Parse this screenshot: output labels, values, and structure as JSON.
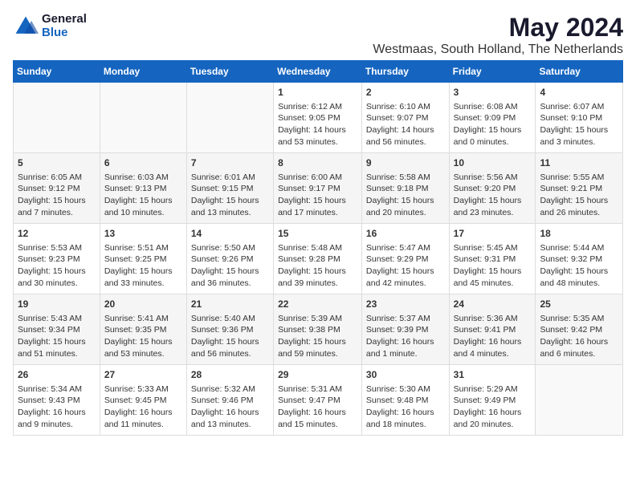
{
  "logo": {
    "general": "General",
    "blue": "Blue"
  },
  "title": {
    "month": "May 2024",
    "location": "Westmaas, South Holland, The Netherlands"
  },
  "weekdays": [
    "Sunday",
    "Monday",
    "Tuesday",
    "Wednesday",
    "Thursday",
    "Friday",
    "Saturday"
  ],
  "weeks": [
    [
      {
        "day": "",
        "content": ""
      },
      {
        "day": "",
        "content": ""
      },
      {
        "day": "",
        "content": ""
      },
      {
        "day": "1",
        "content": "Sunrise: 6:12 AM\nSunset: 9:05 PM\nDaylight: 14 hours and 53 minutes."
      },
      {
        "day": "2",
        "content": "Sunrise: 6:10 AM\nSunset: 9:07 PM\nDaylight: 14 hours and 56 minutes."
      },
      {
        "day": "3",
        "content": "Sunrise: 6:08 AM\nSunset: 9:09 PM\nDaylight: 15 hours and 0 minutes."
      },
      {
        "day": "4",
        "content": "Sunrise: 6:07 AM\nSunset: 9:10 PM\nDaylight: 15 hours and 3 minutes."
      }
    ],
    [
      {
        "day": "5",
        "content": "Sunrise: 6:05 AM\nSunset: 9:12 PM\nDaylight: 15 hours and 7 minutes."
      },
      {
        "day": "6",
        "content": "Sunrise: 6:03 AM\nSunset: 9:13 PM\nDaylight: 15 hours and 10 minutes."
      },
      {
        "day": "7",
        "content": "Sunrise: 6:01 AM\nSunset: 9:15 PM\nDaylight: 15 hours and 13 minutes."
      },
      {
        "day": "8",
        "content": "Sunrise: 6:00 AM\nSunset: 9:17 PM\nDaylight: 15 hours and 17 minutes."
      },
      {
        "day": "9",
        "content": "Sunrise: 5:58 AM\nSunset: 9:18 PM\nDaylight: 15 hours and 20 minutes."
      },
      {
        "day": "10",
        "content": "Sunrise: 5:56 AM\nSunset: 9:20 PM\nDaylight: 15 hours and 23 minutes."
      },
      {
        "day": "11",
        "content": "Sunrise: 5:55 AM\nSunset: 9:21 PM\nDaylight: 15 hours and 26 minutes."
      }
    ],
    [
      {
        "day": "12",
        "content": "Sunrise: 5:53 AM\nSunset: 9:23 PM\nDaylight: 15 hours and 30 minutes."
      },
      {
        "day": "13",
        "content": "Sunrise: 5:51 AM\nSunset: 9:25 PM\nDaylight: 15 hours and 33 minutes."
      },
      {
        "day": "14",
        "content": "Sunrise: 5:50 AM\nSunset: 9:26 PM\nDaylight: 15 hours and 36 minutes."
      },
      {
        "day": "15",
        "content": "Sunrise: 5:48 AM\nSunset: 9:28 PM\nDaylight: 15 hours and 39 minutes."
      },
      {
        "day": "16",
        "content": "Sunrise: 5:47 AM\nSunset: 9:29 PM\nDaylight: 15 hours and 42 minutes."
      },
      {
        "day": "17",
        "content": "Sunrise: 5:45 AM\nSunset: 9:31 PM\nDaylight: 15 hours and 45 minutes."
      },
      {
        "day": "18",
        "content": "Sunrise: 5:44 AM\nSunset: 9:32 PM\nDaylight: 15 hours and 48 minutes."
      }
    ],
    [
      {
        "day": "19",
        "content": "Sunrise: 5:43 AM\nSunset: 9:34 PM\nDaylight: 15 hours and 51 minutes."
      },
      {
        "day": "20",
        "content": "Sunrise: 5:41 AM\nSunset: 9:35 PM\nDaylight: 15 hours and 53 minutes."
      },
      {
        "day": "21",
        "content": "Sunrise: 5:40 AM\nSunset: 9:36 PM\nDaylight: 15 hours and 56 minutes."
      },
      {
        "day": "22",
        "content": "Sunrise: 5:39 AM\nSunset: 9:38 PM\nDaylight: 15 hours and 59 minutes."
      },
      {
        "day": "23",
        "content": "Sunrise: 5:37 AM\nSunset: 9:39 PM\nDaylight: 16 hours and 1 minute."
      },
      {
        "day": "24",
        "content": "Sunrise: 5:36 AM\nSunset: 9:41 PM\nDaylight: 16 hours and 4 minutes."
      },
      {
        "day": "25",
        "content": "Sunrise: 5:35 AM\nSunset: 9:42 PM\nDaylight: 16 hours and 6 minutes."
      }
    ],
    [
      {
        "day": "26",
        "content": "Sunrise: 5:34 AM\nSunset: 9:43 PM\nDaylight: 16 hours and 9 minutes."
      },
      {
        "day": "27",
        "content": "Sunrise: 5:33 AM\nSunset: 9:45 PM\nDaylight: 16 hours and 11 minutes."
      },
      {
        "day": "28",
        "content": "Sunrise: 5:32 AM\nSunset: 9:46 PM\nDaylight: 16 hours and 13 minutes."
      },
      {
        "day": "29",
        "content": "Sunrise: 5:31 AM\nSunset: 9:47 PM\nDaylight: 16 hours and 15 minutes."
      },
      {
        "day": "30",
        "content": "Sunrise: 5:30 AM\nSunset: 9:48 PM\nDaylight: 16 hours and 18 minutes."
      },
      {
        "day": "31",
        "content": "Sunrise: 5:29 AM\nSunset: 9:49 PM\nDaylight: 16 hours and 20 minutes."
      },
      {
        "day": "",
        "content": ""
      }
    ]
  ]
}
